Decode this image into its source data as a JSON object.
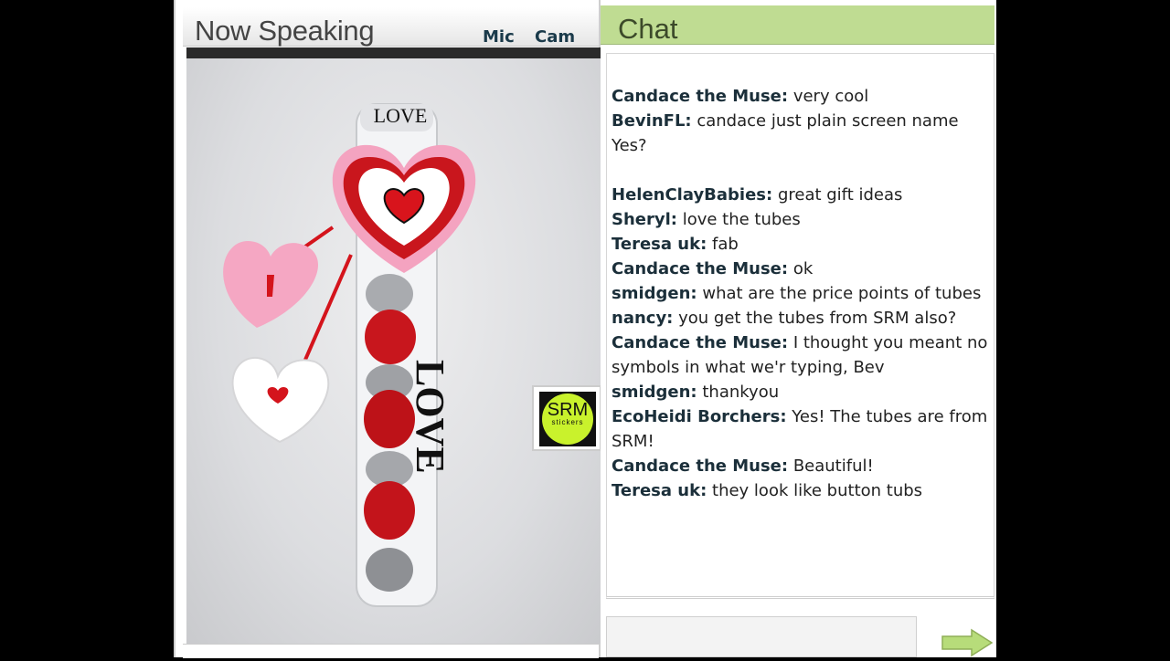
{
  "left_panel": {
    "title": "Now Speaking",
    "mic_label": "Mic",
    "cam_label": "Cam"
  },
  "video": {
    "tube_top_label": "LOVE",
    "tube_side_label": "LOVE",
    "logo_text": "SRM",
    "logo_subtext": "stickers"
  },
  "chat": {
    "title": "Chat",
    "messages": [
      {
        "user": "Candace the Muse:",
        "text": " very cool"
      },
      {
        "user": "BevinFL:",
        "text": " candace  just plain screen name Yes?"
      },
      {
        "user": "HelenClayBabies:",
        "text": " great gift ideas"
      },
      {
        "user": "Sheryl:",
        "text": " love the tubes"
      },
      {
        "user": "Teresa uk:",
        "text": " fab"
      },
      {
        "user": "Candace the Muse:",
        "text": " ok"
      },
      {
        "user": "smidgen:",
        "text": " what are the price points of tubes"
      },
      {
        "user": "nancy:",
        "text": " you get the tubes from SRM also?"
      },
      {
        "user": "Candace the Muse:",
        "text": " I thought you meant no symbols in what we'r typing, Bev"
      },
      {
        "user": "smidgen:",
        "text": " thankyou"
      },
      {
        "user": "EcoHeidi Borchers:",
        "text": " Yes! The tubes are from SRM!"
      },
      {
        "user": "Candace the Muse:",
        "text": " Beautiful!"
      },
      {
        "user": "Teresa uk:",
        "text": " they look like button tubs"
      }
    ],
    "input_value": "",
    "send_icon": "arrow-right-icon"
  },
  "colors": {
    "chat_header_bg": "#bfdc92",
    "send_arrow": "#b7dc7a",
    "logo_green": "#c9f22c"
  }
}
